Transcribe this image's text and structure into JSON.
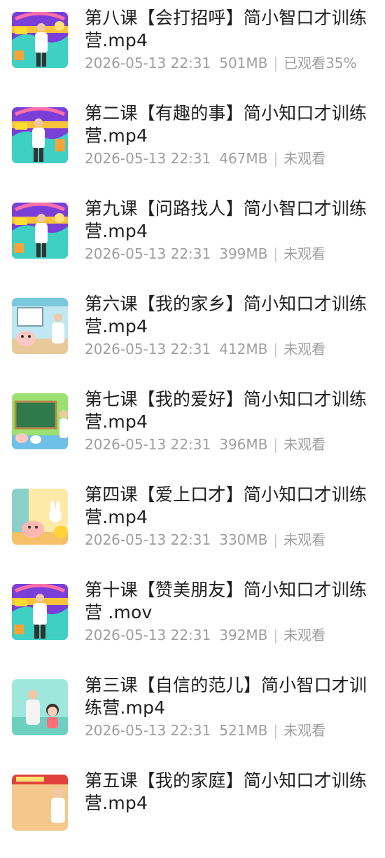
{
  "files": [
    {
      "title": "第八课【会打招呼】简小智口才训练营.mp4",
      "date": "2026-05-13 22:31",
      "size": "501MB",
      "status": "已观看35%",
      "thumb": "stage-purple"
    },
    {
      "title": "第二课【有趣的事】简小知口才训练营.mp4",
      "date": "2026-05-13 22:31",
      "size": "467MB",
      "status": "未观看",
      "thumb": "stage-purple"
    },
    {
      "title": "第九课【问路找人】简小智口才训练营.mp4",
      "date": "2026-05-13 22:31",
      "size": "399MB",
      "status": "未观看",
      "thumb": "stage-purple"
    },
    {
      "title": "第六课【我的家乡】简小知口才训练营.mp4",
      "date": "2026-05-13 22:31",
      "size": "412MB",
      "status": "未观看",
      "thumb": "classroom-blue"
    },
    {
      "title": "第七课【我的爱好】简小知口才训练营.mp4",
      "date": "2026-05-13 22:31",
      "size": "396MB",
      "status": "未观看",
      "thumb": "chalkboard-green"
    },
    {
      "title": "第四课【爱上口才】简小知口才训练营.mp4",
      "date": "2026-05-13 22:31",
      "size": "330MB",
      "status": "未观看",
      "thumb": "cartoon-yellow"
    },
    {
      "title": "第十课【赞美朋友】简小知口才训练营 .mov",
      "date": "2026-05-13 22:31",
      "size": "392MB",
      "status": "未观看",
      "thumb": "stage-purple"
    },
    {
      "title": "第三课【自信的范儿】简小智口才训练营.mp4",
      "date": "2026-05-13 22:31",
      "size": "521MB",
      "status": "未观看",
      "thumb": "teal-scene"
    },
    {
      "title": "第五课【我的家庭】简小知口才训练营.mp4",
      "date": "",
      "size": "",
      "status": "",
      "thumb": "family-red"
    }
  ],
  "colors": {
    "title_text": "#1f1f1f",
    "meta_text": "#9e9e9e",
    "separator": "#c9c9c9",
    "background": "#ffffff"
  }
}
